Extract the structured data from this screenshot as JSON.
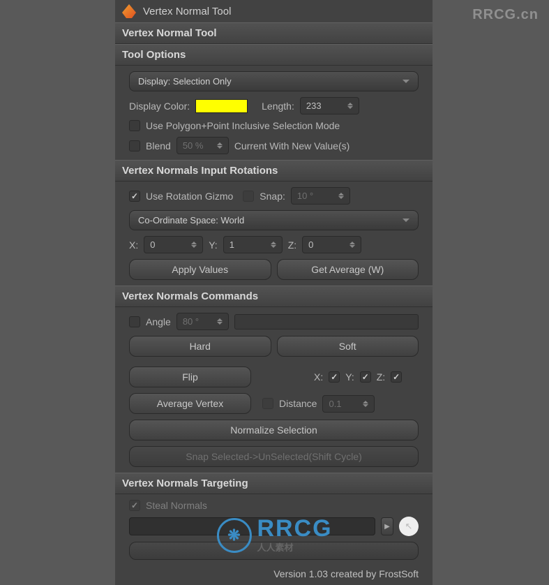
{
  "watermark": {
    "topRight": "RRCG.cn",
    "center": "RRCG",
    "sub": "人人素材"
  },
  "header": {
    "title": "Vertex Normal Tool"
  },
  "panelTitle": "Vertex Normal Tool",
  "toolOptions": {
    "title": "Tool Options",
    "displayDropdown": "Display: Selection Only",
    "displayColorLabel": "Display Color:",
    "displayColor": "#ffff00",
    "lengthLabel": "Length:",
    "lengthValue": "233",
    "usePolygonLabel": "Use Polygon+Point Inclusive Selection Mode",
    "blendLabel": "Blend",
    "blendPercent": "50 %",
    "currentWithLabel": "Current With New Value(s)"
  },
  "inputRotations": {
    "title": "Vertex Normals Input Rotations",
    "useRotationLabel": "Use Rotation Gizmo",
    "snapLabel": "Snap:",
    "snapValue": "10 °",
    "coordSpaceDropdown": "Co-Ordinate Space: World",
    "xLabel": "X:",
    "xValue": "0",
    "yLabel": "Y:",
    "yValue": "1",
    "zLabel": "Z:",
    "zValue": "0",
    "applyValuesBtn": "Apply Values",
    "getAverageBtn": "Get Average (W)"
  },
  "commands": {
    "title": "Vertex Normals Commands",
    "angleLabel": "Angle",
    "angleValue": "80 °",
    "hardBtn": "Hard",
    "softBtn": "Soft",
    "flipBtn": "Flip",
    "flipXLabel": "X:",
    "flipYLabel": "Y:",
    "flipZLabel": "Z:",
    "avgVertexBtn": "Average Vertex",
    "distanceLabel": "Distance",
    "distanceValue": "0.1",
    "normalizeBtn": "Normalize Selection",
    "snapSelectedBtn": "Snap Selected->UnSelected(Shift Cycle)"
  },
  "targeting": {
    "title": "Vertex Normals Targeting",
    "stealNormalsLabel": "Steal Normals"
  },
  "footer": "Version 1.03 created by FrostSoft"
}
